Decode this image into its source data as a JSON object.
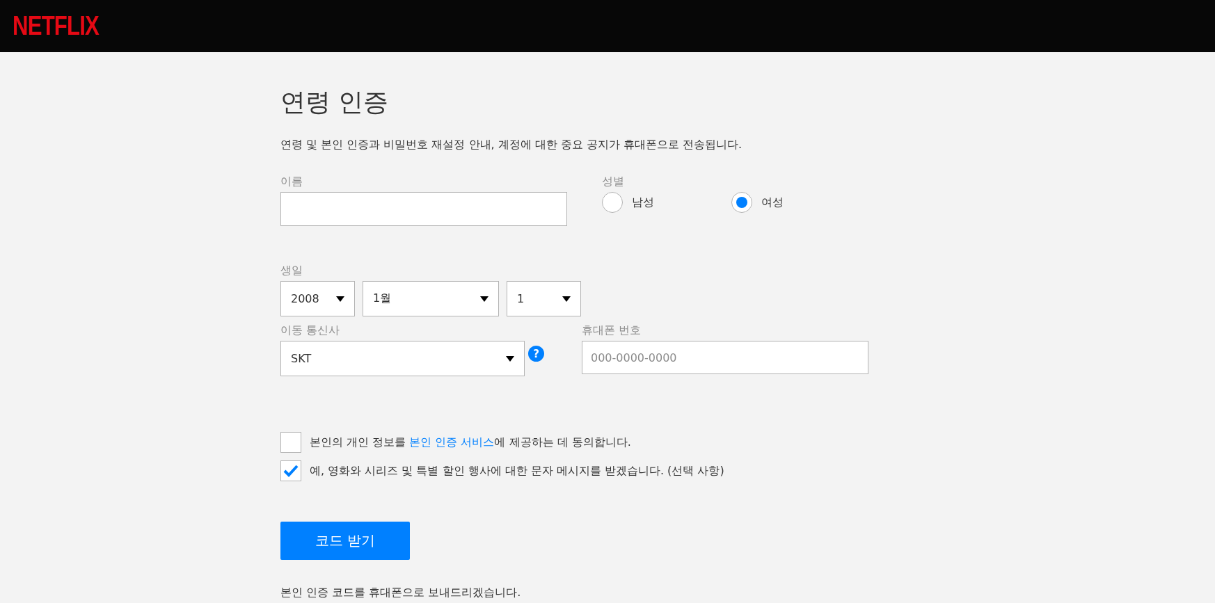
{
  "header": {
    "logo": "NETFLIX"
  },
  "title": "연령 인증",
  "intro": "연령 및 본인 인증과 비밀번호 재설정 안내, 계정에 대한 중요 공지가 휴대폰으로 전송됩니다.",
  "name_field": {
    "label": "이름"
  },
  "gender": {
    "label": "성별",
    "options": [
      {
        "label": "남성",
        "selected": false
      },
      {
        "label": "여성",
        "selected": true
      }
    ]
  },
  "birthday": {
    "label": "생일",
    "selects": [
      {
        "value": "2008",
        "kind": "narrow"
      },
      {
        "value": "1월",
        "kind": "wide"
      },
      {
        "value": "1",
        "kind": "narrow"
      }
    ]
  },
  "carrier": {
    "label": "이동 통신사",
    "value": "SKT",
    "help": "?"
  },
  "phone": {
    "label": "휴대폰 번호",
    "placeholder": "000-0000-0000"
  },
  "consents": [
    {
      "checked": false,
      "before": "본인의 개인 정보를 ",
      "link": "본인 인증 서비스",
      "after": "에 제공하는 데 동의합니다."
    },
    {
      "checked": true,
      "before": "예, 영화와 시리즈 및 특별 할인 행사에 대한 문자 메시지를 받겠습니다. (선택 사항)"
    }
  ],
  "submit": "코드 받기",
  "footer_note": "본인 인증 코드를 휴대폰으로 보내드리겠습니다."
}
